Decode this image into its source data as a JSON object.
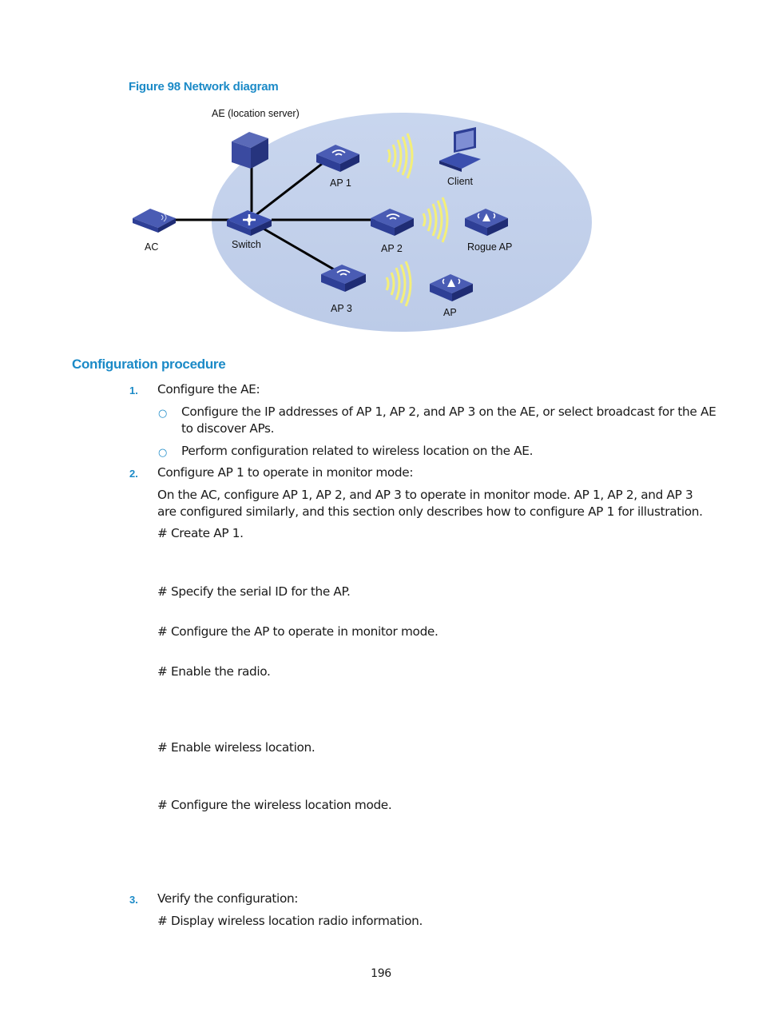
{
  "figure": {
    "caption": "Figure 98 Network diagram",
    "labels": {
      "ae": "AE (location server)",
      "ap1": "AP 1",
      "client": "Client",
      "ac": "AC",
      "switch": "Switch",
      "ap2": "AP 2",
      "rogue_ap": "Rogue AP",
      "ap3": "AP 3",
      "ap": "AP"
    },
    "colors": {
      "zone_fill": "#c4d3ec",
      "device_blue": "#2e3f96",
      "signal_yellow": "#f4ef7a",
      "link": "#000000"
    }
  },
  "section": {
    "title": "Configuration procedure"
  },
  "steps": [
    {
      "number": "1.",
      "text": "Configure the AE:",
      "subitems": [
        {
          "bullet": "○",
          "lines": [
            "Configure the IP addresses of AP 1, AP 2, and AP 3 on the AE, or select broadcast for the AE",
            "to discover APs."
          ]
        },
        {
          "bullet": "○",
          "lines": [
            "Perform configuration related to wireless location on the AE."
          ]
        }
      ]
    },
    {
      "number": "2.",
      "text": "Configure AP 1 to operate in monitor mode:",
      "paragraph": [
        "On the AC, configure AP 1, AP 2, and AP 3 to operate in monitor mode. AP 1, AP 2, and AP 3",
        "are configured similarly, and this section only describes how to configure AP 1 for illustration."
      ],
      "comments": [
        "# Create AP 1.",
        "# Specify the serial ID for the AP.",
        "# Configure the AP to operate in monitor mode.",
        "# Enable the radio.",
        "# Enable wireless location.",
        "# Configure the wireless location mode."
      ]
    },
    {
      "number": "3.",
      "text": "Verify the configuration:",
      "comments": [
        "# Display wireless location radio information."
      ]
    }
  ],
  "page_number": "196"
}
